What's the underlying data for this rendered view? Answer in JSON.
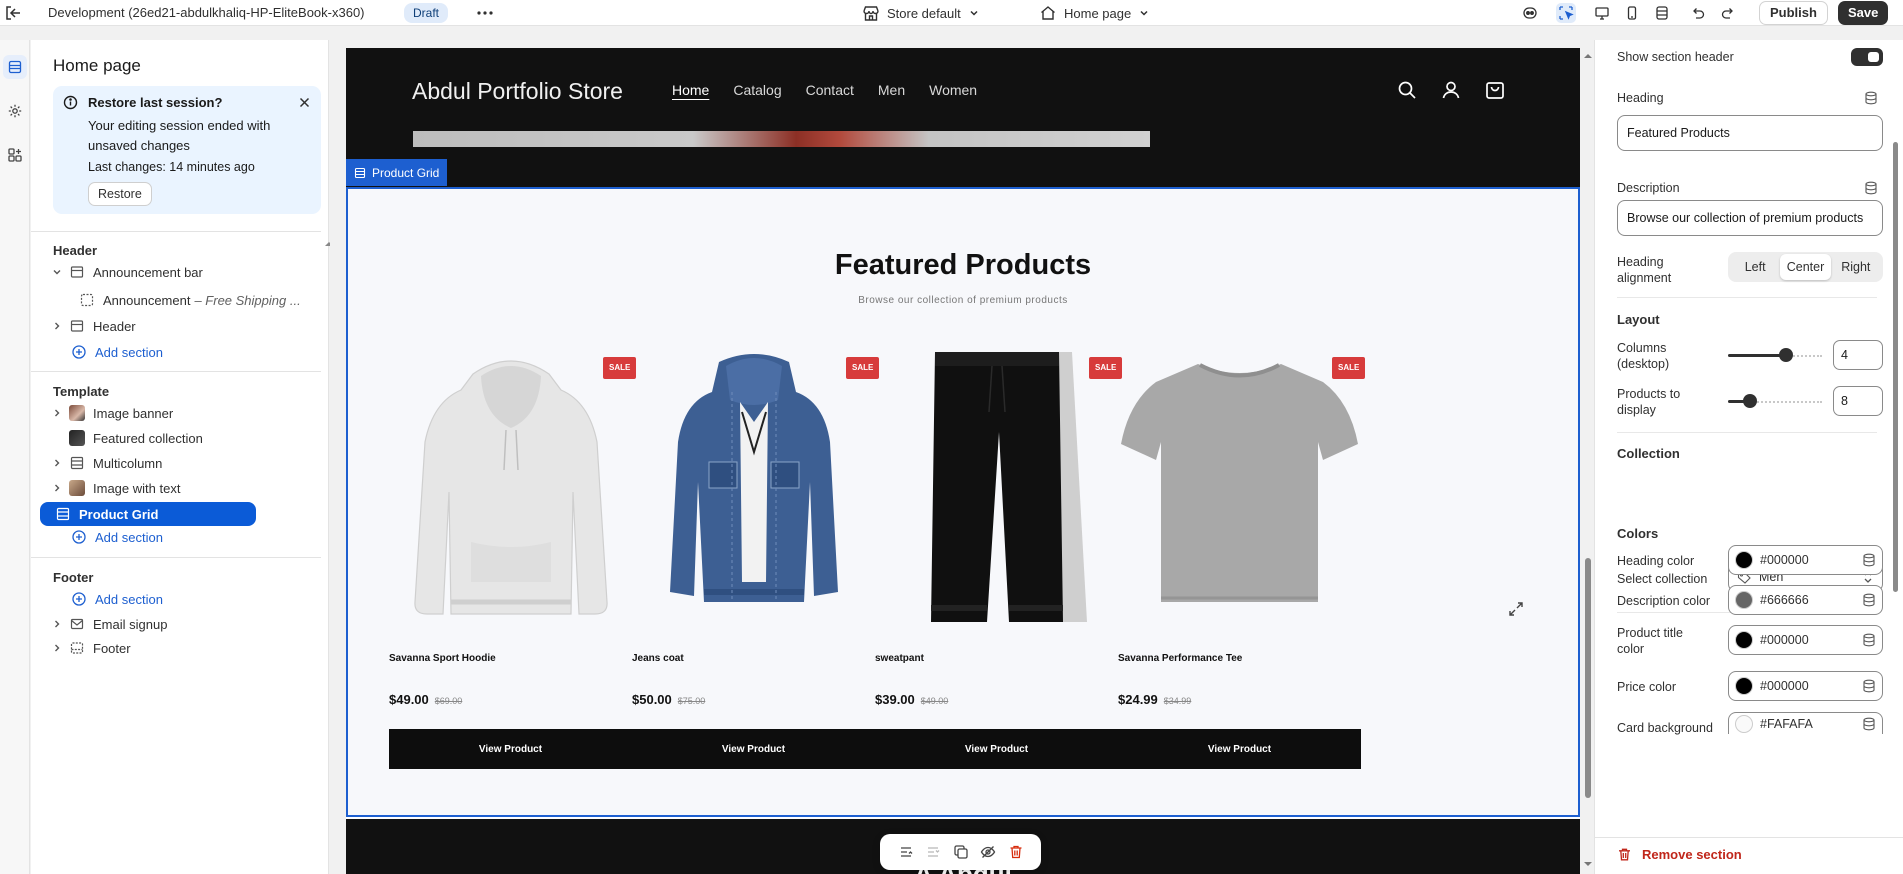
{
  "topbar": {
    "store_name": "Development (26ed21-abdulkhaliq-HP-EliteBook-x360)",
    "status_badge": "Draft",
    "theme_selector": "Store default",
    "page_selector": "Home page",
    "publish_label": "Publish",
    "save_label": "Save"
  },
  "left_panel": {
    "title": "Home page",
    "session": {
      "title": "Restore last session?",
      "body": "Your editing session ended with unsaved changes",
      "last_changes": "Last changes: 14 minutes ago",
      "restore_label": "Restore"
    },
    "header_group": {
      "title": "Header",
      "announcement_bar": "Announcement bar",
      "announcement": "Announcement",
      "announcement_detail": "– Free Shipping ...",
      "header": "Header",
      "add_section": "Add section"
    },
    "template_group": {
      "title": "Template",
      "items": [
        "Image banner",
        "Featured collection",
        "Multicolumn",
        "Image with text",
        "Product Grid"
      ],
      "add_section": "Add section"
    },
    "footer_group": {
      "title": "Footer",
      "add_section": "Add section",
      "email_signup": "Email signup",
      "footer": "Footer"
    }
  },
  "preview": {
    "store_title": "Abdul Portfolio Store",
    "nav": [
      "Home",
      "Catalog",
      "Contact",
      "Men",
      "Women"
    ],
    "section_tag": "Product Grid",
    "heading": "Featured Products",
    "description": "Browse our collection of premium products",
    "sale_badge": "SALE",
    "view_button": "View Product",
    "products": [
      {
        "name": "Savanna Sport Hoodie",
        "price": "$49.00",
        "compare": "$69.00"
      },
      {
        "name": "Jeans coat",
        "price": "$50.00",
        "compare": "$75.00"
      },
      {
        "name": "sweatpant",
        "price": "$39.00",
        "compare": "$49.00"
      },
      {
        "name": "Savanna Performance Tee",
        "price": "$24.99",
        "compare": "$34.99"
      }
    ],
    "next_section_heading": "A     Abdul"
  },
  "settings": {
    "show_section_header_label": "Show section header",
    "show_section_header": true,
    "heading_label": "Heading",
    "heading_value": "Featured Products",
    "description_label": "Description",
    "description_value": "Browse our collection of premium products",
    "heading_alignment_label": "Heading alignment",
    "alignment_options": [
      "Left",
      "Center",
      "Right"
    ],
    "alignment_selected": "Center",
    "layout_title": "Layout",
    "columns_label": "Columns (desktop)",
    "columns_value": "4",
    "products_label": "Products to display",
    "products_value": "8",
    "collection_title": "Collection",
    "select_collection_label": "Select collection",
    "select_collection_value": "Men",
    "colors_title": "Colors",
    "heading_color_label": "Heading color",
    "heading_color": "#000000",
    "description_color_label": "Description color",
    "description_color": "#666666",
    "product_title_color_label": "Product title color",
    "product_title_color": "#000000",
    "price_color_label": "Price color",
    "price_color": "#000000",
    "card_background_label": "Card background",
    "card_background": "#FAFAFA",
    "remove_label": "Remove section"
  },
  "colors": {
    "accent": "#1d5fd0",
    "selected_row": "#0b5bd7",
    "sale": "#d73b3b",
    "danger": "#c0261a"
  }
}
